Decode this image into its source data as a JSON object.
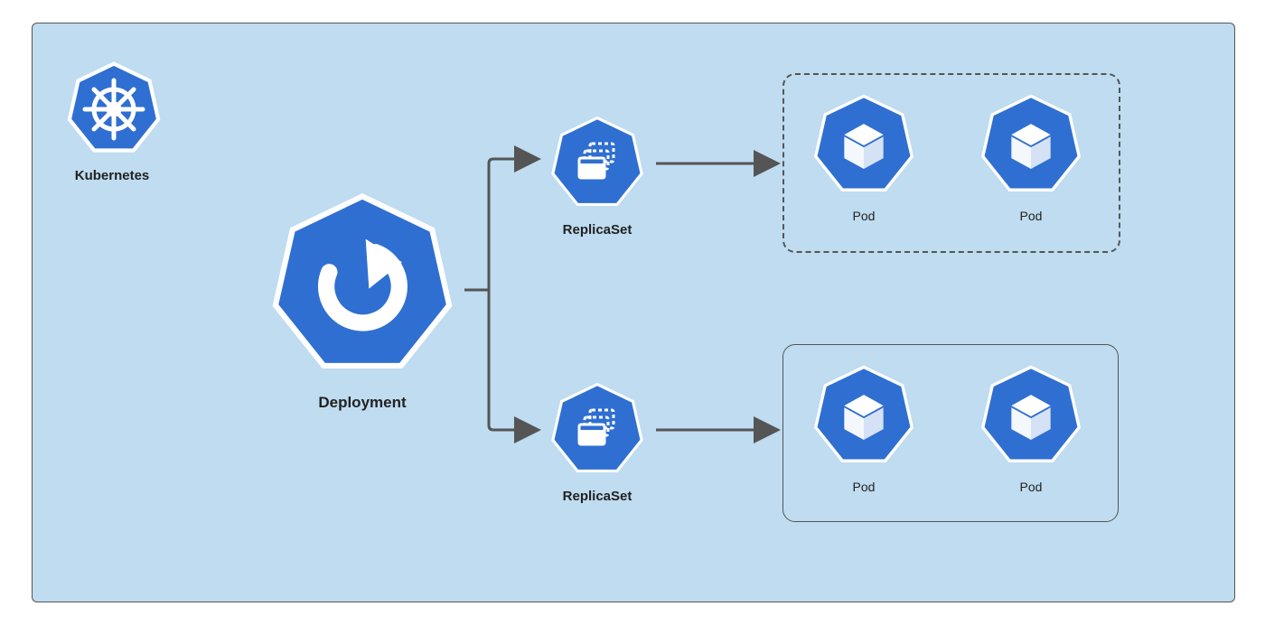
{
  "diagram": {
    "title_label": "Kubernetes",
    "deployment_label": "Deployment",
    "replicaset_label_top": "ReplicaSet",
    "replicaset_label_bottom": "ReplicaSet",
    "pod_label_1": "Pod",
    "pod_label_2": "Pod",
    "pod_label_3": "Pod",
    "pod_label_4": "Pod"
  },
  "colors": {
    "blue": "#2f6fd1",
    "bg": "#bfdcf0",
    "border": "#555"
  }
}
